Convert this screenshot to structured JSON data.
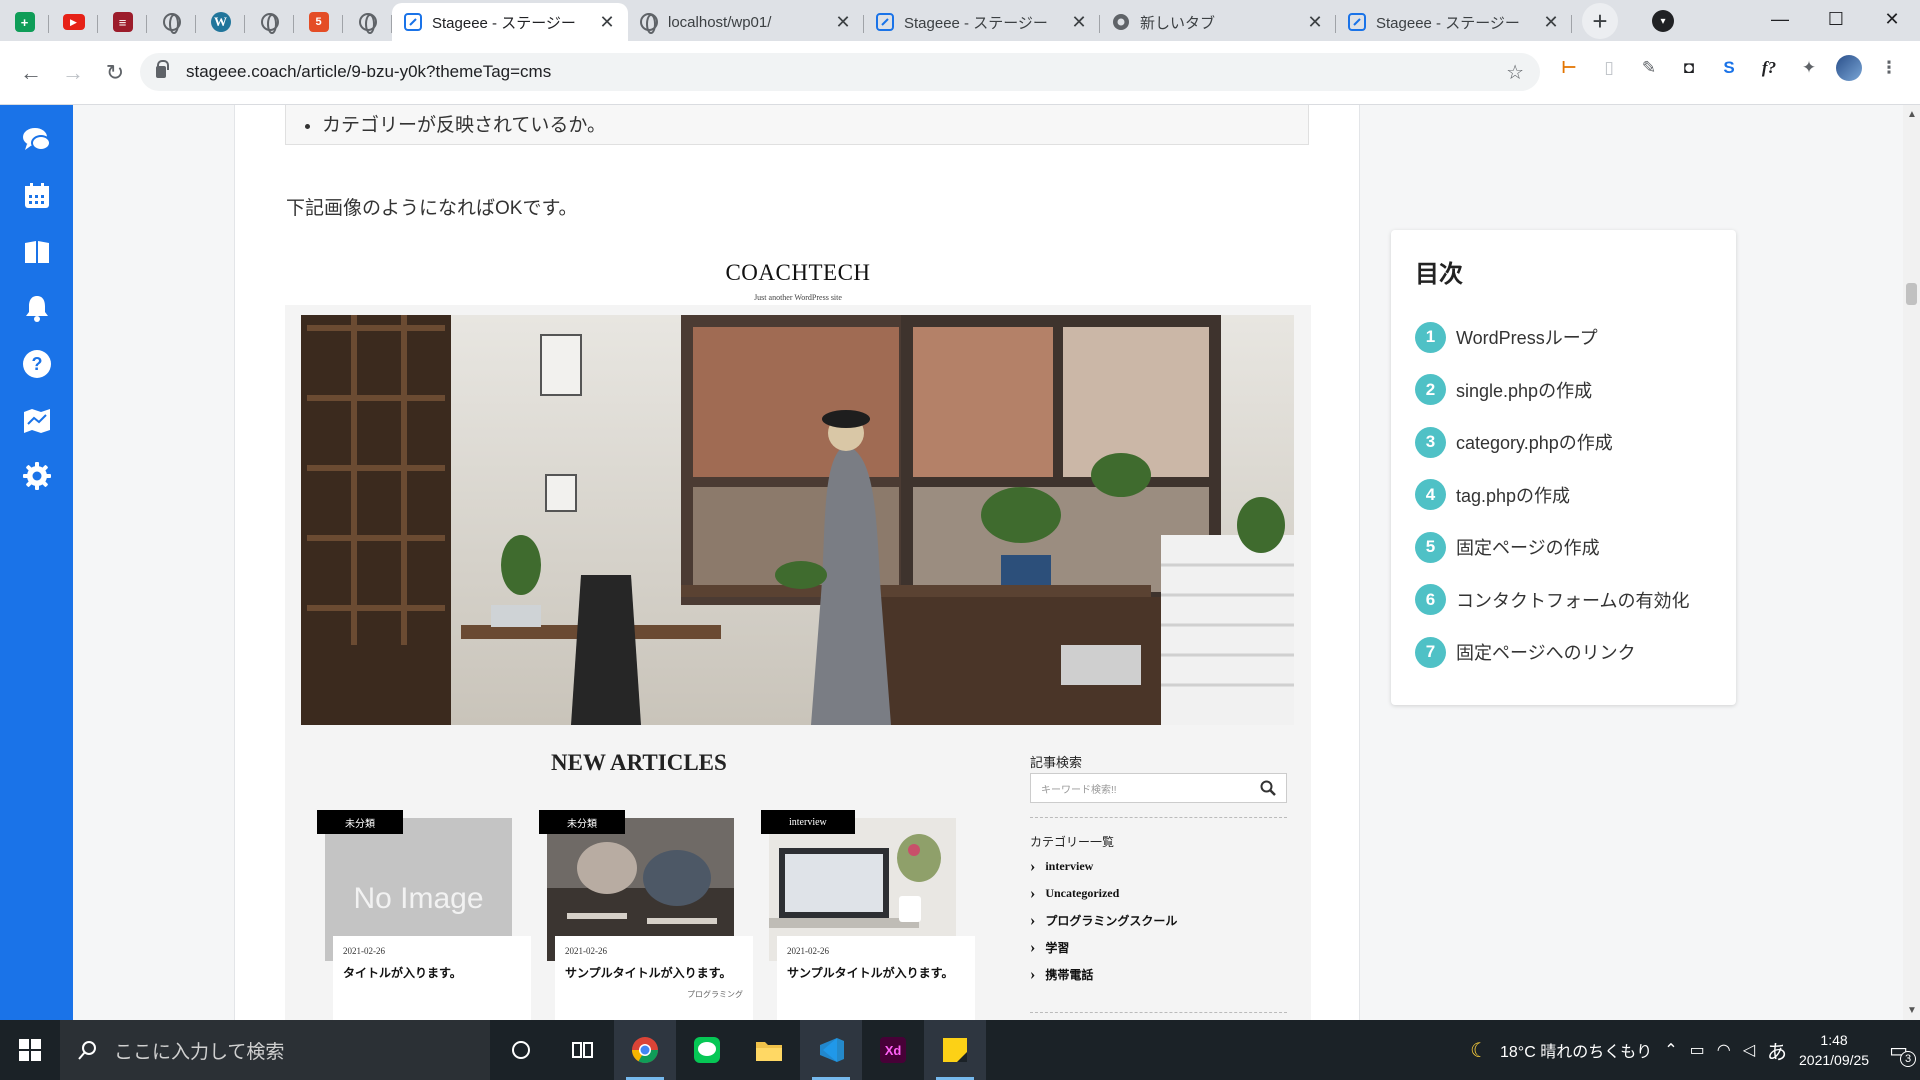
{
  "browser": {
    "tabs": [
      {
        "title": "Stageee - ステージー",
        "active": true
      },
      {
        "title": "localhost/wp01/",
        "active": false
      },
      {
        "title": "Stageee - ステージー",
        "active": false
      },
      {
        "title": "新しいタブ",
        "active": false
      },
      {
        "title": "Stageee - ステージー",
        "active": false
      }
    ],
    "close_glyph": "✕",
    "new_tab_glyph": "+",
    "url": "stageee.coach/article/9-bzu-y0k?themeTag=cms",
    "window_controls": {
      "minimize": "—",
      "maximize": "☐",
      "close": "✕"
    }
  },
  "article": {
    "checklist_item": "カテゴリーが反映されているか。",
    "lead_text": "下記画像のようになればOKです。",
    "screenshot": {
      "brand": "COACHTECH",
      "tagline": "Just another WordPress site",
      "section_title": "NEW ARTICLES",
      "search_heading": "記事検索",
      "search_placeholder": "キーワード検索!!",
      "category_heading": "カテゴリー一覧",
      "categories": [
        "interview",
        "Uncategorized",
        "プログラミングスクール",
        "学習",
        "携帯電話"
      ],
      "cards": [
        {
          "badge": "未分類",
          "date": "2021-02-26",
          "title": "タイトルが入ります。",
          "sub": "",
          "thumb_text": "No Image"
        },
        {
          "badge": "未分類",
          "date": "2021-02-26",
          "title": "サンプルタイトルが入ります。",
          "sub": "プログラミング",
          "thumb_text": ""
        },
        {
          "badge": "interview",
          "date": "2021-02-26",
          "title": "サンプルタイトルが入ります。",
          "sub": "",
          "thumb_text": ""
        }
      ]
    }
  },
  "toc": {
    "heading": "目次",
    "items": [
      {
        "num": "1",
        "label": "WordPressループ"
      },
      {
        "num": "2",
        "label": "single.phpの作成"
      },
      {
        "num": "3",
        "label": "category.phpの作成"
      },
      {
        "num": "4",
        "label": "tag.phpの作成"
      },
      {
        "num": "5",
        "label": "固定ページの作成"
      },
      {
        "num": "6",
        "label": "コンタクトフォームの有効化"
      },
      {
        "num": "7",
        "label": "固定ページへのリンク"
      }
    ]
  },
  "taskbar": {
    "search_placeholder": "ここに入力して検索",
    "weather": "18°C 晴れのちくもり",
    "ime": "あ",
    "time": "1:48",
    "date": "2021/09/25",
    "notification_count": "3"
  },
  "colors": {
    "app_nav": "#1a73e8",
    "toc_badge": "#4fc1c6",
    "taskbar": "#1b2227"
  }
}
